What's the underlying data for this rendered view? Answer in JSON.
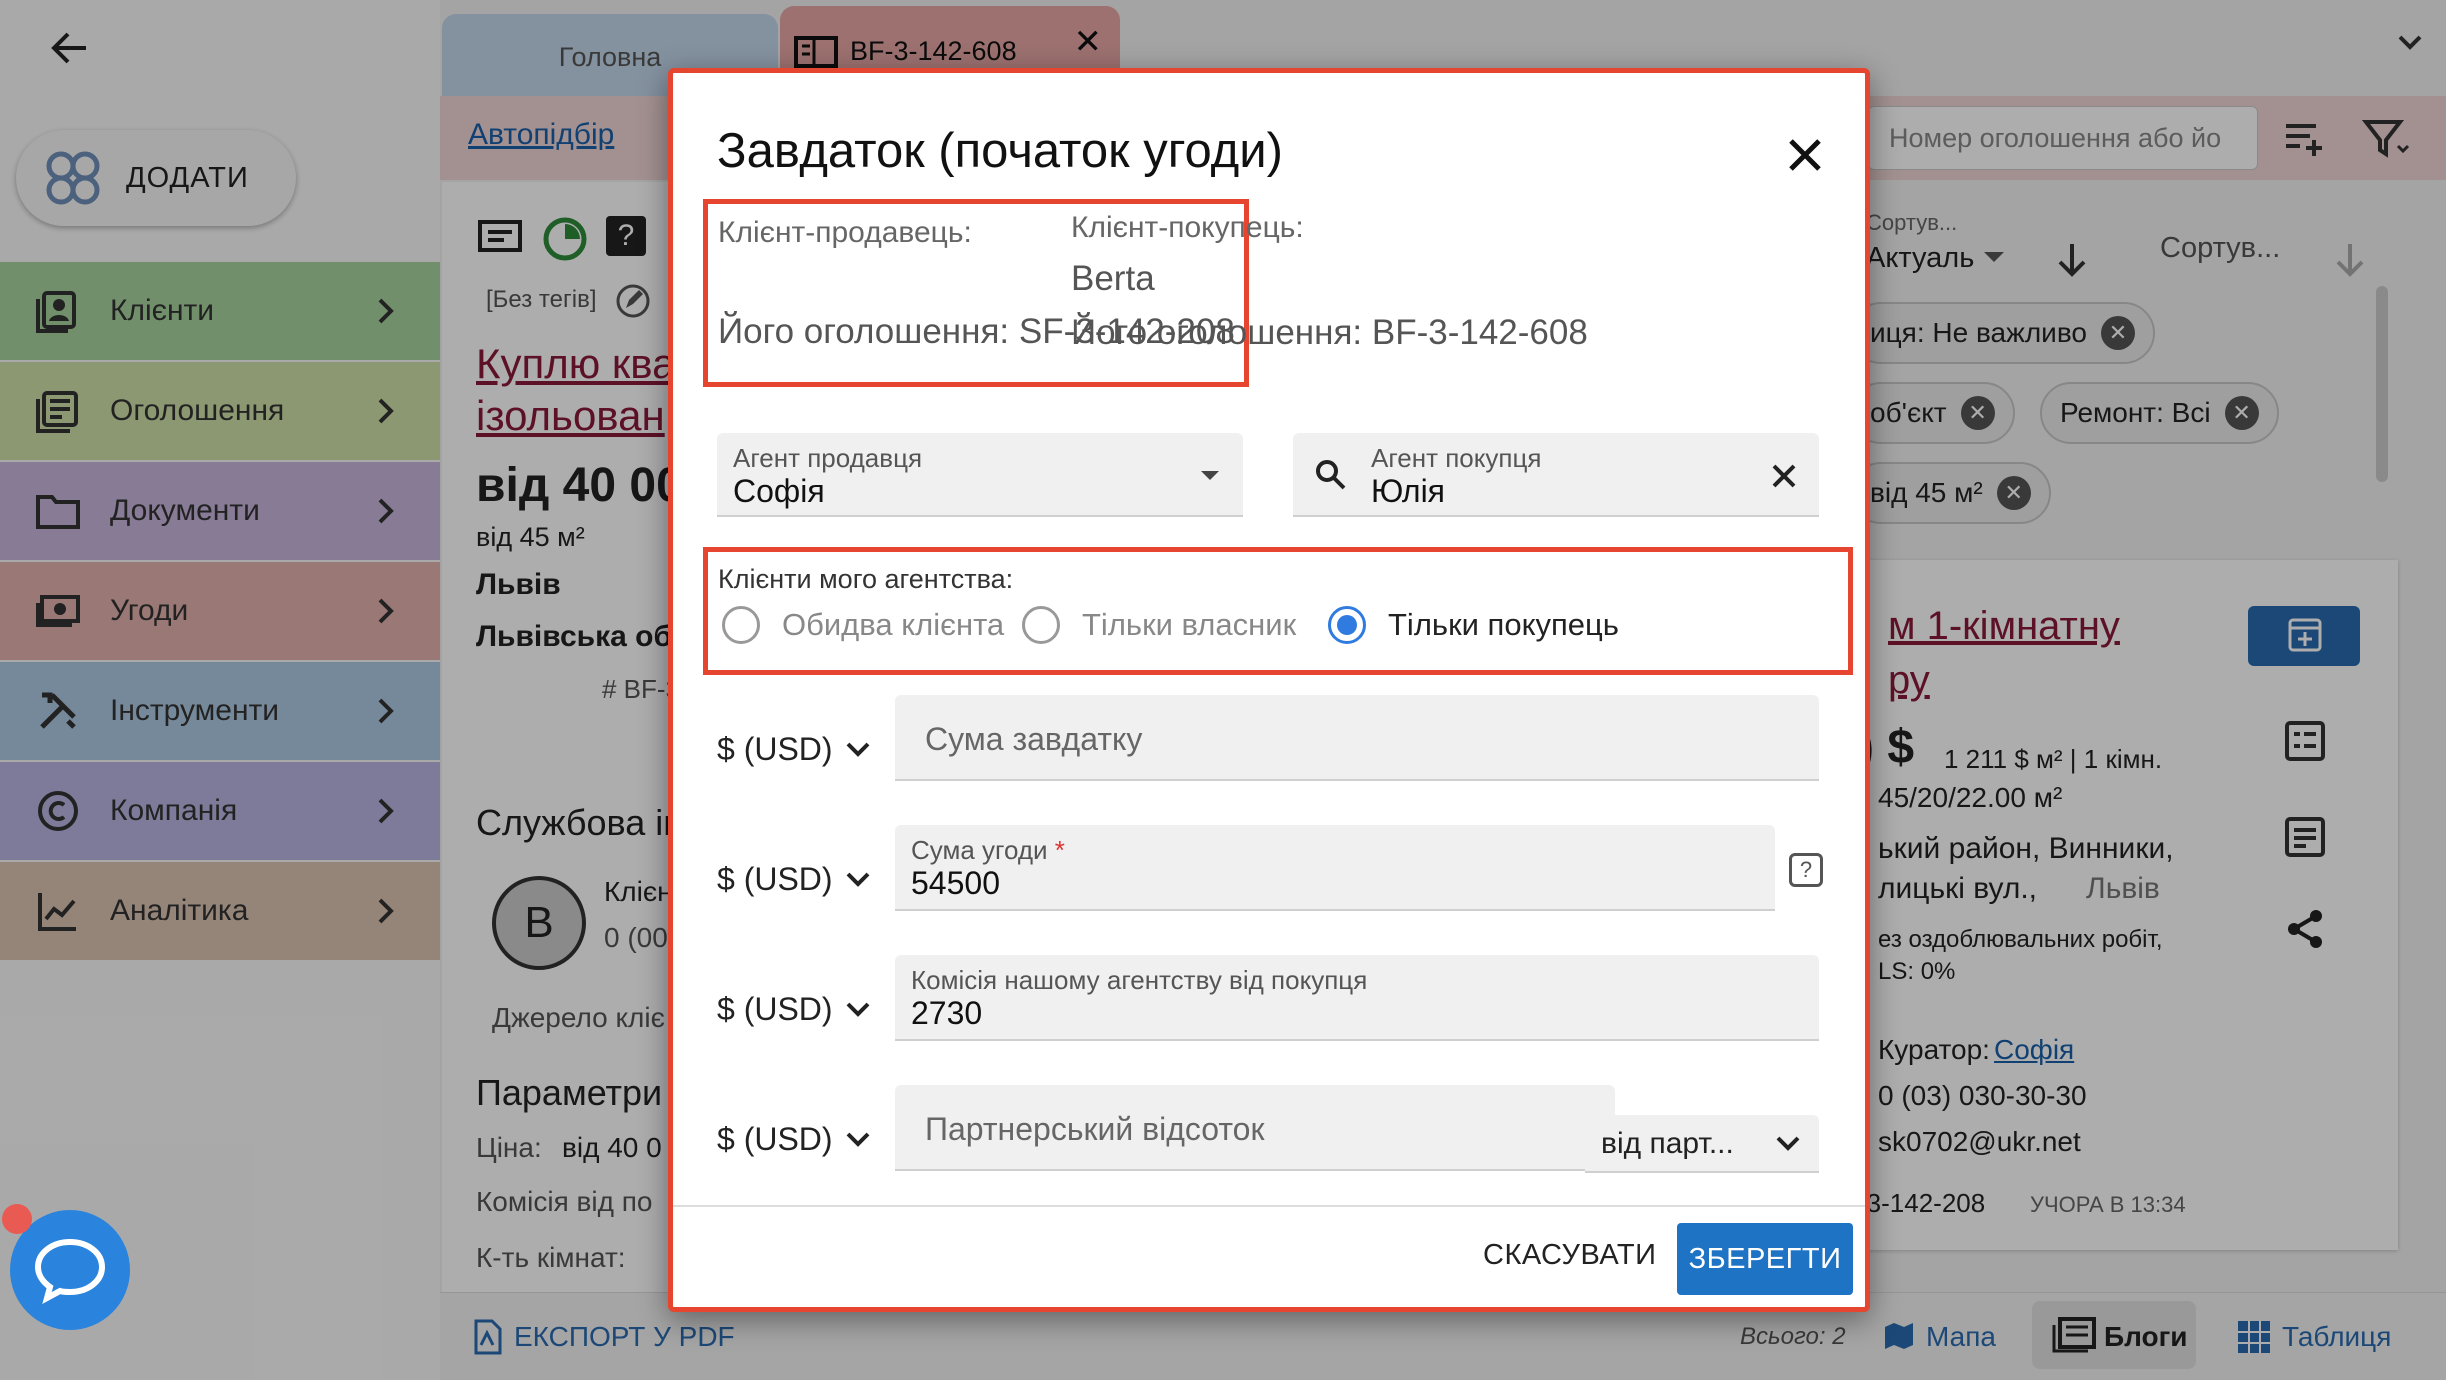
{
  "sidebar": {
    "add_label": "ДОДАТИ",
    "items": [
      {
        "label": "Клієнти",
        "color": "#a9d3a0",
        "icon": "clients-icon"
      },
      {
        "label": "Оголошення",
        "color": "#cde0a7",
        "icon": "listings-icon"
      },
      {
        "label": "Документи",
        "color": "#c7b6de",
        "icon": "folder-icon"
      },
      {
        "label": "Угоди",
        "color": "#e2b2ad",
        "icon": "deals-icon"
      },
      {
        "label": "Інструменти",
        "color": "#aecbe4",
        "icon": "tools-icon"
      },
      {
        "label": "Компанія",
        "color": "#b9b6e2",
        "icon": "copyright-icon"
      },
      {
        "label": "Аналітика",
        "color": "#dcc4b3",
        "icon": "analytics-icon"
      }
    ]
  },
  "tabs": {
    "home": "Головна",
    "listing": "BF-3-142-608"
  },
  "background": {
    "autopick": "Автопідбір",
    "search_placeholder": "Номер оголошення або йо",
    "no_tags": "[Без тегів]",
    "title_line1": "Куплю ква",
    "title_line2": "ізольован",
    "price": "від 40 00",
    "area": "від 45 м²",
    "city": "Львів",
    "region": "Львівська об",
    "id_prefix": "# BF-3",
    "service_info": "Службова ін",
    "avatar_letter": "B",
    "client_short": "Клієн",
    "client_count": "0 (00",
    "source": "Джерело кліє",
    "params": "Параметри",
    "param_price_label": "Ціна:",
    "param_price_value": "від 40 0",
    "param_commission": "Комісія від по",
    "param_rooms": "К-ть кімнат:",
    "sort1_label": "Сортув...",
    "sort1_value": "Актуаль",
    "sort2": "Сортув...",
    "chip1": "иця: Не важливо",
    "chip2": "об'єкт",
    "chip3": "Ремонт: Всі",
    "chip4": "від 45 м²",
    "card_title1": "м 1-кімнатну",
    "card_title2": "ру",
    "card_price": ") $",
    "card_price_meta": "1 211 $ м² | 1 кімн.",
    "card_area": "45/20/22.00 м²",
    "card_addr1": "ький район, Винники,",
    "card_addr2": "лицькі вул.,",
    "card_city": "Львів",
    "card_repair": "ез оздоблювальних робіт,",
    "card_mls": "LS: 0%",
    "curator_label": "Куратор:",
    "curator_name": "Софія",
    "phone": "0 (03) 030-30-30",
    "email": "sk0702@ukr.net",
    "card_id": "-3-142-208",
    "card_time": "УЧОРА В 13:34",
    "export_pdf": "ЕКСПОРТ У PDF",
    "total": "Всього: 2",
    "view_map": "Мапа",
    "view_blogs": "Блоги",
    "view_table": "Таблиця"
  },
  "dialog": {
    "title": "Завдаток (початок угоди)",
    "seller_label": "Клієнт-продавець:",
    "seller_listing": "Його оголошення: SF-3-142-208",
    "buyer_label": "Клієнт-покупець:",
    "buyer_name": "Berta",
    "buyer_listing": "Його оголошення: BF-3-142-608",
    "seller_agent_label": "Агент продавця",
    "seller_agent_value": "Софія",
    "buyer_agent_label": "Агент покупця",
    "buyer_agent_value": "Юлія",
    "clients_group_label": "Клієнти мого агентства:",
    "radio_both": "Обидва клієнта",
    "radio_owner": "Тільки власник",
    "radio_buyer": "Тільки покупець",
    "radio_selected": "radio_buyer",
    "currency": "$ (USD)",
    "deposit_placeholder": "Сума завдатку",
    "deal_amount_label": "Сума угоди",
    "required_mark": "*",
    "deal_amount_value": "54500",
    "help_mark": "?",
    "commission_label": "Комісія нашому агентству від покупця",
    "commission_value": "2730",
    "partner_placeholder": "Партнерський відсоток",
    "partner_from": "від парт...",
    "cancel": "СКАСУВАТИ",
    "save": "ЗБЕРЕГТИ"
  },
  "colors": {
    "accent": "#1f73c5",
    "highlight": "#e6452f",
    "radio": "#2f7be0"
  }
}
